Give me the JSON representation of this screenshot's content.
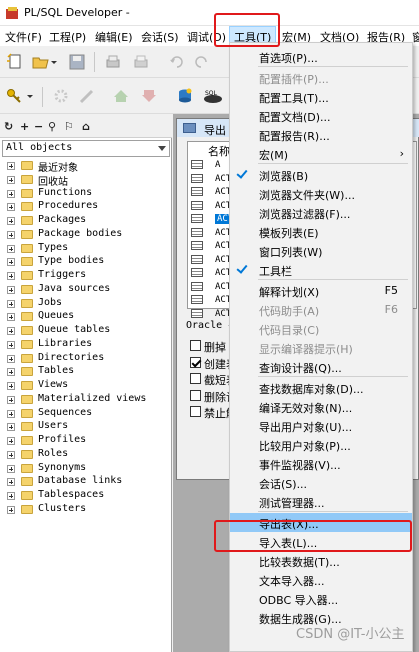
{
  "window": {
    "title": "PL/SQL Developer  -"
  },
  "menubar": {
    "items": [
      "文件(F)",
      "工程(P)",
      "编辑(E)",
      "会话(S)",
      "调试(D)",
      "工具(T)",
      "宏(M)",
      "文档(O)",
      "报告(R)",
      "窗"
    ]
  },
  "left_panel": {
    "tools": [
      "↻",
      "+",
      "−",
      "⚲",
      "⚐",
      "⌂"
    ],
    "object_selector": "All objects",
    "tree": [
      "最近对象",
      "回收站",
      "Functions",
      "Procedures",
      "Packages",
      "Package bodies",
      "Types",
      "Type bodies",
      "Triggers",
      "Java sources",
      "Jobs",
      "Queues",
      "Queue tables",
      "Libraries",
      "Directories",
      "Tables",
      "Views",
      "Materialized views",
      "Sequences",
      "Users",
      "Profiles",
      "Roles",
      "Synonyms",
      "Database links",
      "Tablespaces",
      "Clusters"
    ]
  },
  "export_window": {
    "title": "导出",
    "header": "名称",
    "rows": [
      "A",
      "ACT",
      "ACT",
      "ACT",
      "ACT",
      "ACT",
      "ACT",
      "ACT",
      "ACT",
      "ACT",
      "ACT",
      "ACT"
    ],
    "tab": "Oracle 导",
    "options": [
      {
        "label": "删掉",
        "checked": false
      },
      {
        "label": "创建表",
        "checked": true
      },
      {
        "label": "截短表",
        "checked": false
      },
      {
        "label": "删除记",
        "checked": false
      },
      {
        "label": "禁止触",
        "checked": false
      }
    ]
  },
  "tools_menu": {
    "items": [
      {
        "label": "首选项(P)...",
        "disabled": false
      },
      {
        "sep": true
      },
      {
        "label": "配置插件(P)...",
        "disabled": true
      },
      {
        "label": "配置工具(T)...",
        "disabled": false
      },
      {
        "label": "配置文档(D)...",
        "disabled": false
      },
      {
        "label": "配置报告(R)...",
        "disabled": false
      },
      {
        "label": "宏(M)",
        "disabled": false,
        "submenu": true
      },
      {
        "sep": true
      },
      {
        "label": "浏览器(B)",
        "disabled": false,
        "checked": true
      },
      {
        "label": "浏览器文件夹(W)...",
        "disabled": false
      },
      {
        "label": "浏览器过滤器(F)...",
        "disabled": false
      },
      {
        "label": "模板列表(E)",
        "disabled": false
      },
      {
        "label": "窗口列表(W)",
        "disabled": false
      },
      {
        "label": "工具栏",
        "disabled": false,
        "checked": true
      },
      {
        "sep": true
      },
      {
        "label": "解释计划(X)",
        "shortcut": "F5",
        "disabled": false
      },
      {
        "label": "代码助手(A)",
        "shortcut": "F6",
        "disabled": true
      },
      {
        "label": "代码目录(C)",
        "disabled": true
      },
      {
        "label": "显示编译器提示(H)",
        "disabled": true
      },
      {
        "label": "查询设计器(Q)...",
        "disabled": false
      },
      {
        "sep": true
      },
      {
        "label": "查找数据库对象(D)...",
        "disabled": false
      },
      {
        "label": "编译无效对象(N)...",
        "disabled": false
      },
      {
        "label": "导出用户对象(U)...",
        "disabled": false
      },
      {
        "label": "比较用户对象(P)...",
        "disabled": false
      },
      {
        "label": "事件监视器(V)...",
        "disabled": false
      },
      {
        "label": "会话(S)...",
        "disabled": false
      },
      {
        "label": "测试管理器...",
        "disabled": false
      },
      {
        "sep": true
      },
      {
        "label": "导出表(X)...",
        "disabled": false,
        "highlight": true
      },
      {
        "label": "导入表(L)...",
        "disabled": false
      },
      {
        "label": "比较表数据(T)...",
        "disabled": false
      },
      {
        "label": "文本导入器...",
        "disabled": false
      },
      {
        "label": "ODBC 导入器...",
        "disabled": false
      },
      {
        "label": "数据生成器(G)...",
        "disabled": false
      }
    ]
  },
  "watermark": "CSDN @IT-小公主",
  "colors": {
    "annotation": "#e0191b",
    "highlight": "#91c9f7",
    "selection": "#0078d7",
    "check": "#0078d7"
  }
}
